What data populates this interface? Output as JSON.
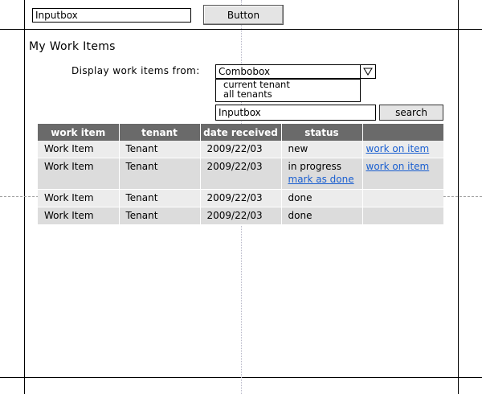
{
  "top_bar": {
    "input_value": "Inputbox",
    "button_label": "Button"
  },
  "title": "My Work Items",
  "filter": {
    "label": "Display work items from:",
    "combo_value": "Combobox",
    "options": [
      "current tenant",
      "all tenants"
    ]
  },
  "search": {
    "input_value": "Inputbox",
    "button_label": "search"
  },
  "table": {
    "columns": [
      "work item",
      "tenant",
      "date received",
      "status",
      ""
    ],
    "rows": [
      {
        "item": "Work Item",
        "tenant": "Tenant",
        "date": "2009/22/03",
        "status": "new",
        "status_link": "",
        "action": "work on item"
      },
      {
        "item": "Work Item",
        "tenant": "Tenant",
        "date": "2009/22/03",
        "status": "in progress",
        "status_link": "mark as done",
        "action": "work on item"
      },
      {
        "item": "Work Item",
        "tenant": "Tenant",
        "date": "2009/22/03",
        "status": "done",
        "status_link": "",
        "action": ""
      },
      {
        "item": "Work Item",
        "tenant": "Tenant",
        "date": "2009/22/03",
        "status": "done",
        "status_link": "",
        "action": ""
      }
    ]
  },
  "colors": {
    "header_bg": "#6a6a6a",
    "row_light": "#ececec",
    "row_dark": "#dcdcdc",
    "link": "#1a5fd0"
  }
}
